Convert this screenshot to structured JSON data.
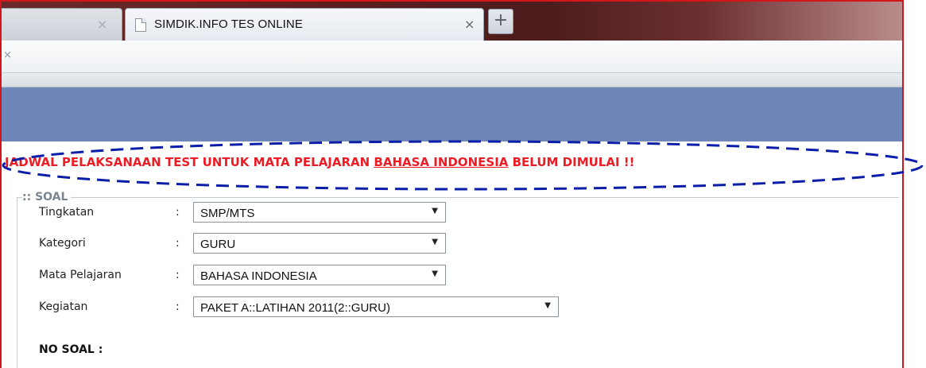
{
  "browser": {
    "inactive_tab_close": "×",
    "active_tab": {
      "title": "SIMDIK.INFO TES ONLINE",
      "close": "×"
    },
    "new_tab_label": "+",
    "address_close": "×"
  },
  "alert": {
    "prefix": "JADWAL PELAKSANAAN TEST UNTUK MATA PELAJARAN ",
    "subject": "BAHASA INDONESIA",
    "suffix": " BELUM DIMULAI !!"
  },
  "form": {
    "legend": ":: SOAL",
    "colon": ":",
    "fields": [
      {
        "label": "Tingkatan",
        "value": "SMP/MTS"
      },
      {
        "label": "Kategori",
        "value": "GURU"
      },
      {
        "label": "Mata Pelajaran",
        "value": "BAHASA INDONESIA"
      },
      {
        "label": "Kegiatan",
        "value": "PAKET A::LATIHAN 2011(2::GURU)"
      }
    ],
    "no_soal_label": "NO SOAL :"
  },
  "colors": {
    "alert_text": "#ed1c24",
    "header_band": "#6f86b9",
    "annotation_oval": "#0a1ea8",
    "frame_border": "#d2161b"
  },
  "icons": [
    "document-icon",
    "close-icon",
    "plus-icon",
    "dropdown-arrow-icon"
  ]
}
